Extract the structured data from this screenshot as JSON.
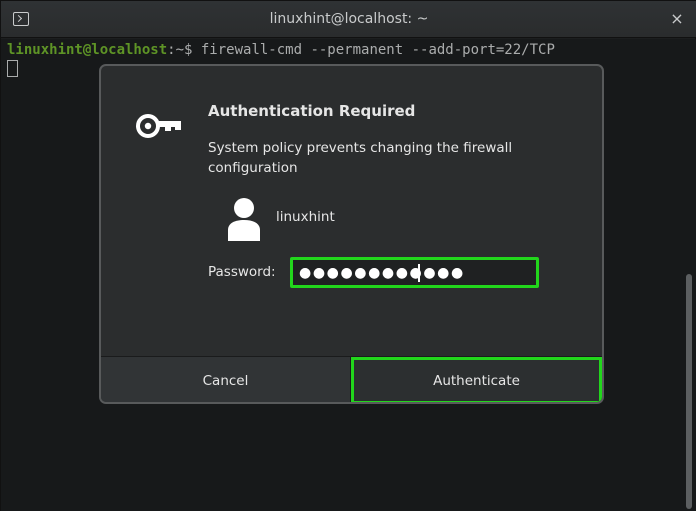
{
  "window": {
    "title": "linuxhint@localhost: ~",
    "close_glyph": "×"
  },
  "terminal": {
    "user_host": "linuxhint@localhost",
    "prompt_suffix": ":~$ ",
    "command": "firewall-cmd --permanent --add-port=22/TCP"
  },
  "dialog": {
    "title": "Authentication Required",
    "message": "System policy prevents changing the firewall configuration",
    "username": "linuxhint",
    "password_label": "Password:",
    "password_masked": "●●●●●●●●●●●●",
    "cancel_label": "Cancel",
    "authenticate_label": "Authenticate",
    "icons": {
      "key": "key-icon",
      "user": "user-avatar-icon"
    }
  },
  "colors": {
    "terminal_background": "#1c1e1f",
    "prompt_user_host": "#6fae2d",
    "highlight": "#22d61c",
    "dialog_background": "#2b2d2e"
  }
}
